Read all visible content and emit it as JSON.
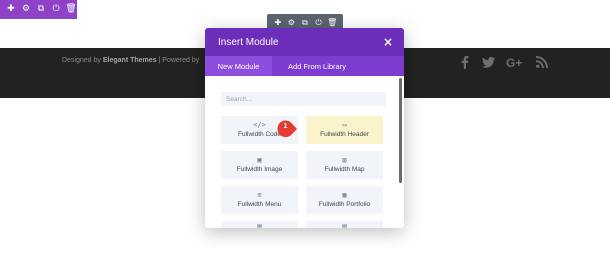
{
  "row_toolbar": {
    "color": "#8e42c7",
    "icons": [
      "add-icon",
      "settings-icon",
      "duplicate-icon",
      "power-icon",
      "trash-icon"
    ],
    "glyphs": [
      "✚",
      "⚙",
      "⧉",
      "⏻",
      "🗑"
    ]
  },
  "section_toolbar": {
    "color": "#5c6470",
    "icons": [
      "add-icon",
      "settings-icon",
      "duplicate-icon",
      "power-icon",
      "trash-icon"
    ],
    "glyphs": [
      "✚",
      "⚙",
      "⧉",
      "⏻",
      "🗑"
    ]
  },
  "footer": {
    "credits_prefix": "Designed by",
    "credits_brand": "Elegant Themes",
    "credits_suffix": " | Powered by",
    "social": [
      "facebook-icon",
      "twitter-icon",
      "google-plus-icon",
      "rss-icon"
    ],
    "social_glyphs": [
      "f",
      "t",
      "G+",
      ")))"
    ]
  },
  "modal": {
    "title": "Insert Module",
    "close": "×",
    "header_color": "#6c2eb9",
    "tabs": [
      {
        "label": "New Module",
        "active": true
      },
      {
        "label": "Add From Library",
        "active": false
      }
    ],
    "search": {
      "placeholder": "Search...",
      "value": ""
    },
    "modules": [
      {
        "label": "Fullwidth Code",
        "icon": "code-icon",
        "glyph": "</>",
        "highlighted": false
      },
      {
        "label": "Fullwidth Header",
        "icon": "header-icon",
        "glyph": "▭",
        "highlighted": true
      },
      {
        "label": "Fullwidth Image",
        "icon": "image-icon",
        "glyph": "▣",
        "highlighted": false
      },
      {
        "label": "Fullwidth Map",
        "icon": "map-icon",
        "glyph": "▥",
        "highlighted": false
      },
      {
        "label": "Fullwidth Menu",
        "icon": "menu-icon",
        "glyph": "≡",
        "highlighted": false
      },
      {
        "label": "Fullwidth Portfolio",
        "icon": "portfolio-icon",
        "glyph": "▦",
        "highlighted": false
      },
      {
        "label": "",
        "icon": "module-icon",
        "glyph": "▤",
        "highlighted": false
      },
      {
        "label": "",
        "icon": "module-icon",
        "glyph": "▤",
        "highlighted": false
      }
    ],
    "highlight_color": "#faf3cc"
  },
  "callout": {
    "number": "1",
    "color": "#e53b34"
  }
}
